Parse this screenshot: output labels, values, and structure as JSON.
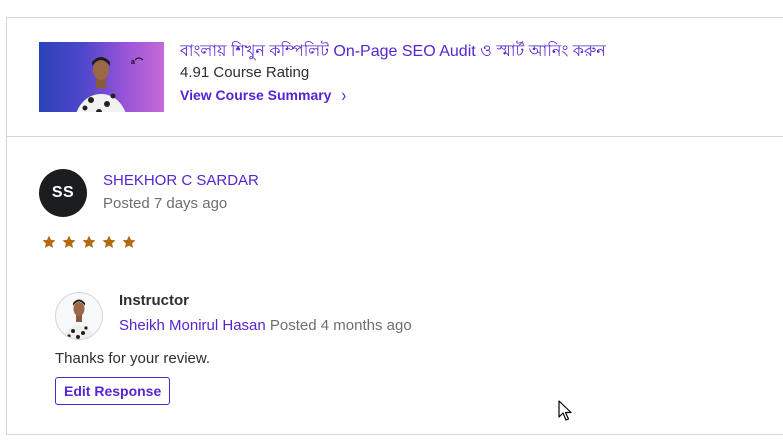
{
  "course": {
    "title": "বাংলায় শিখুন কম্পিলিট On-Page SEO Audit ও স্মার্ট আনিং করুন",
    "rating_text": "4.91 Course Rating",
    "summary_link": "View Course Summary",
    "thumbnail_icon": "instructor-photo"
  },
  "review": {
    "avatar_initials": "SS",
    "reviewer_name": "SHEKHOR C SARDAR",
    "posted": "Posted 7 days ago",
    "stars": 5,
    "star_color": "#b4690e"
  },
  "instructor_response": {
    "label": "Instructor",
    "name": "Sheikh Monirul Hasan",
    "posted": "Posted 4 months ago",
    "text": "Thanks for your review.",
    "edit_button": "Edit Response"
  },
  "colors": {
    "accent": "#5624d0",
    "text": "#2d2f31",
    "muted": "#6a6f73",
    "border": "#d1d7dc"
  }
}
